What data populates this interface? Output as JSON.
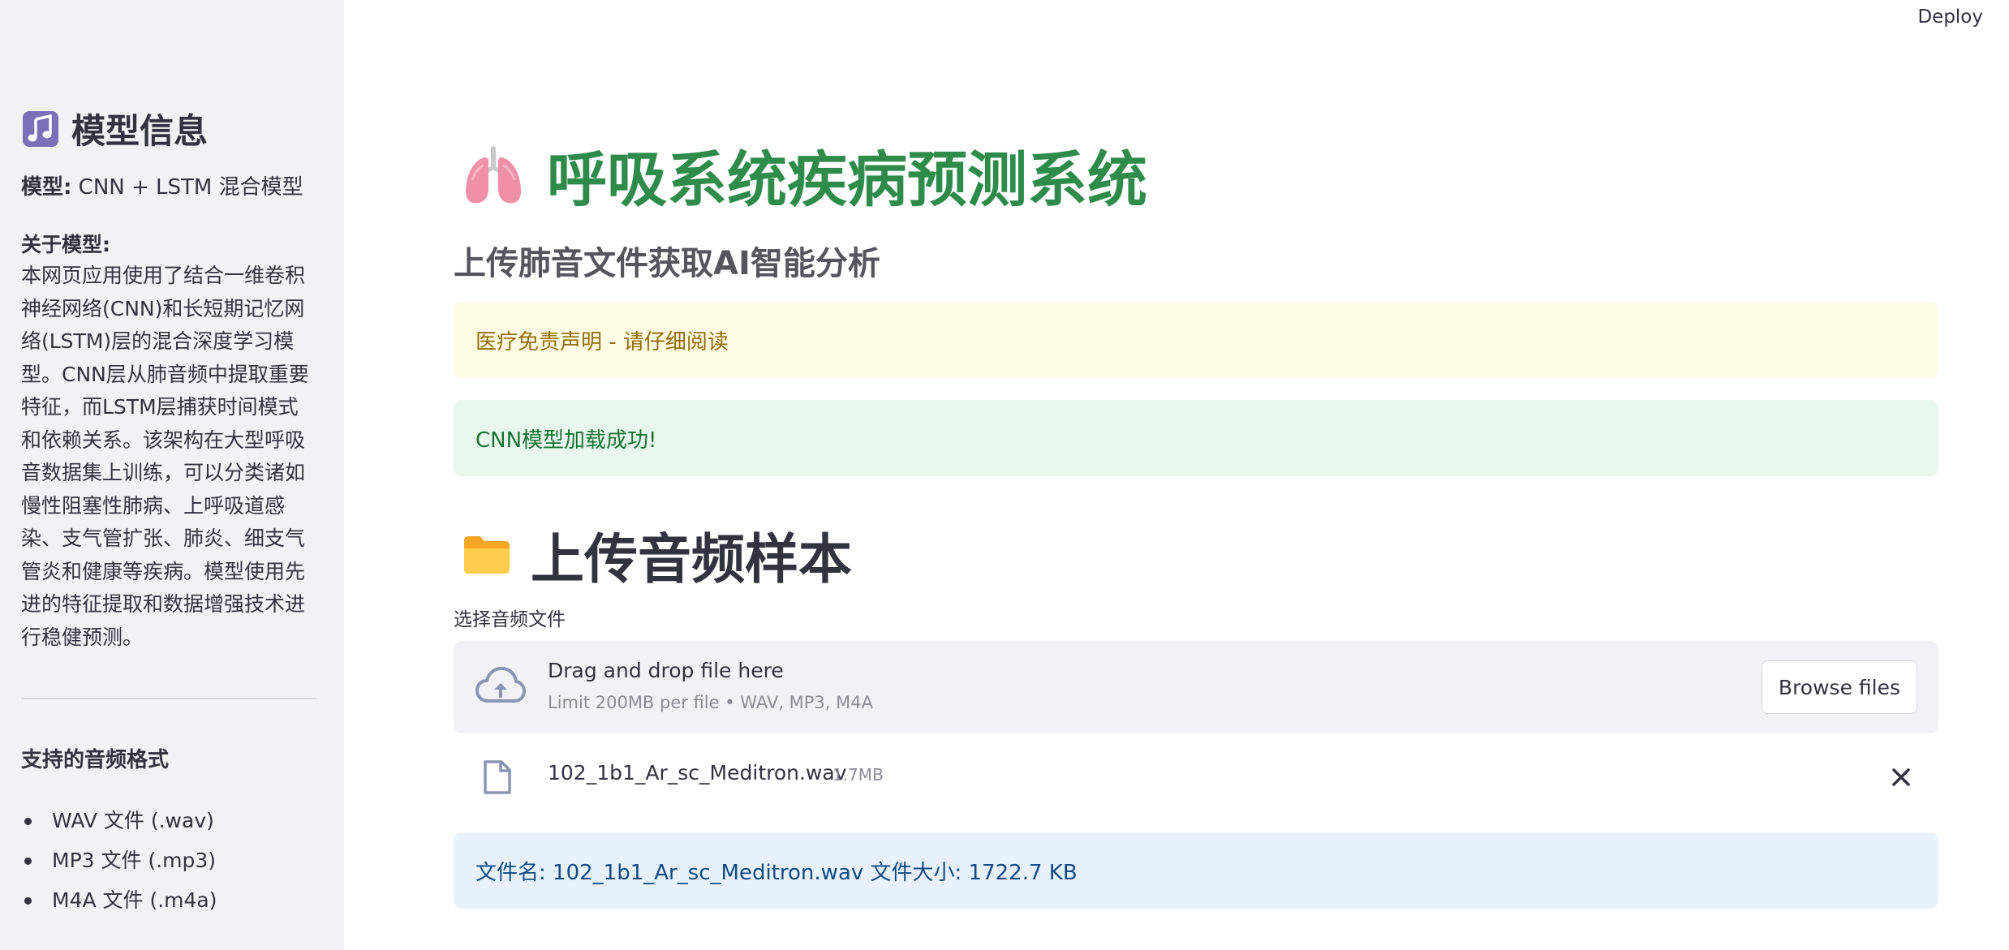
{
  "header": {
    "deploy_label": "Deploy"
  },
  "sidebar": {
    "title": "模型信息",
    "title_icon": "music-note-icon",
    "model_label": "模型:",
    "model_value": " CNN + LSTM 混合模型",
    "about_label": "关于模型:",
    "about_text": "本网页应用使用了结合一维卷积神经网络(CNN)和长短期记忆网络(LSTM)层的混合深度学习模型。CNN层从肺音频中提取重要特征，而LSTM层捕获时间模式和依赖关系。该架构在大型呼吸音数据集上训练，可以分类诸如慢性阻塞性肺病、上呼吸道感染、支气管扩张、肺炎、细支气管炎和健康等疾病。模型使用先进的特征提取和数据增强技术进行稳健预测。",
    "formats_title": "支持的音频格式",
    "formats": [
      "WAV 文件 (.wav)",
      "MP3 文件 (.mp3)",
      "M4A 文件 (.m4a)"
    ]
  },
  "main": {
    "title": "呼吸系统疾病预测系统",
    "title_icon": "lungs-icon",
    "subtitle": "上传肺音文件获取AI智能分析",
    "warning_text": "医疗免责声明 - 请仔细阅读",
    "success_text": "CNN模型加载成功!",
    "section_title": "上传音频样本",
    "section_icon": "folder-icon",
    "upload": {
      "label": "选择音频文件",
      "drag_text": "Drag and drop file here",
      "limit_text": "Limit 200MB per file • WAV, MP3, M4A",
      "browse_label": "Browse files",
      "file_name": "102_1b1_Ar_sc_Meditron.wav",
      "file_size": "1.7MB"
    },
    "info_text": "文件名: 102_1b1_Ar_sc_Meditron.wav 文件大小: 1722.7 KB"
  },
  "colors": {
    "title_green": "#2e8b4a",
    "sidebar_bg": "#f0f2f6",
    "warning_bg": "#fffce6",
    "warning_text": "#926c05",
    "success_bg": "#e8f8ec",
    "success_text": "#177233",
    "info_bg": "#e8f2fc",
    "info_text": "#0c4a85"
  }
}
